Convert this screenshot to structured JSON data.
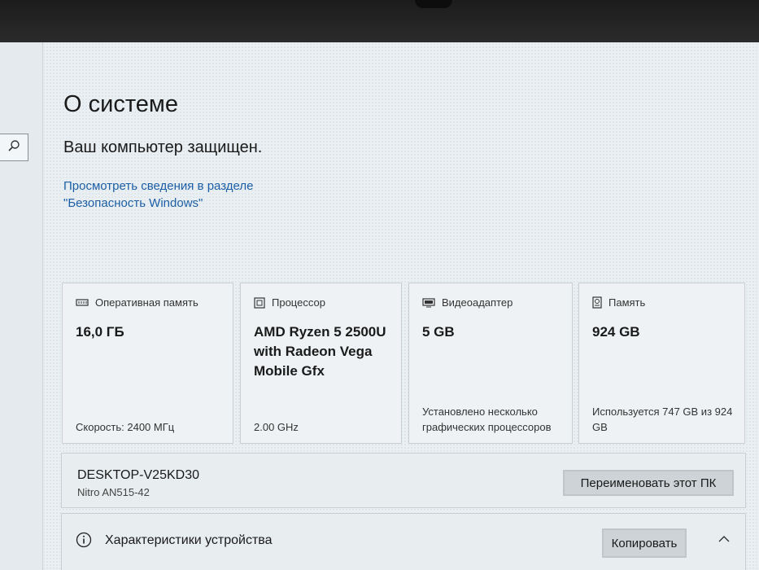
{
  "page": {
    "title": "О системе",
    "protection_status": "Ваш компьютер защищен.",
    "security_link": "Просмотреть сведения в разделе \"Безопасность Windows\""
  },
  "search": {
    "icon": "search-icon"
  },
  "cards": {
    "ram": {
      "label": "Оперативная память",
      "value": "16,0 ГБ",
      "footer": "Скорость: 2400 МГц",
      "icon": "memory-icon"
    },
    "cpu": {
      "label": "Процессор",
      "value": "AMD Ryzen 5 2500U with Radeon Vega Mobile Gfx",
      "footer": "2.00 GHz",
      "icon": "processor-icon"
    },
    "gpu": {
      "label": "Видеоадаптер",
      "value": "5 GB",
      "footer": "Установлено несколько графических процессоров",
      "icon": "display-adapter-icon"
    },
    "storage": {
      "label": "Память",
      "value": "924 GB",
      "footer": "Используется 747 GB из 924 GB",
      "icon": "storage-icon"
    }
  },
  "device": {
    "name": "DESKTOP-V25KD30",
    "model": "Nitro AN515-42",
    "rename_button": "Переименовать этот ПК"
  },
  "specs": {
    "title": "Характеристики устройства",
    "copy_button": "Копировать",
    "icon": "info-icon",
    "chevron": "chevron-up-icon"
  }
}
